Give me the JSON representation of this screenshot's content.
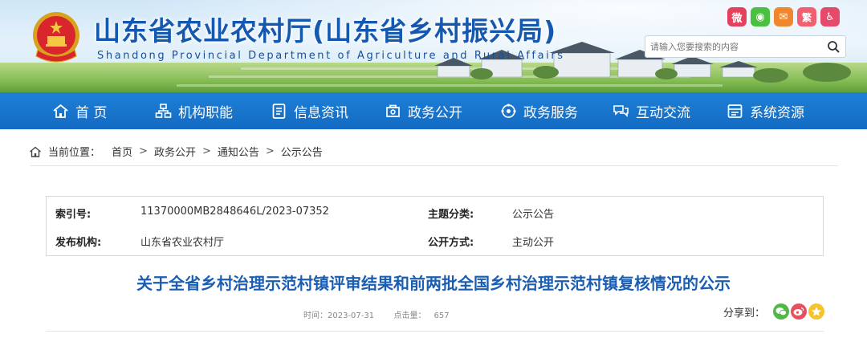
{
  "header": {
    "title": "山东省农业农村厅(山东省乡村振兴局)",
    "subtitle": "Shandong Provincial Department of Agriculture and Rural Affairs",
    "top_icons": [
      {
        "name": "weibo-icon",
        "glyph": "微"
      },
      {
        "name": "wechat-icon",
        "glyph": "◉"
      },
      {
        "name": "mail-icon",
        "glyph": "✉"
      },
      {
        "name": "traditional-chinese-icon",
        "glyph": "繁"
      },
      {
        "name": "accessibility-icon",
        "glyph": "♿"
      }
    ],
    "search": {
      "placeholder": "请输入您要搜索的内容"
    }
  },
  "nav": {
    "items": [
      {
        "label": "首 页",
        "icon": "home-icon"
      },
      {
        "label": "机构职能",
        "icon": "org-chart-icon"
      },
      {
        "label": "信息资讯",
        "icon": "document-icon"
      },
      {
        "label": "政务公开",
        "icon": "public-affairs-icon"
      },
      {
        "label": "政务服务",
        "icon": "service-icon"
      },
      {
        "label": "互动交流",
        "icon": "interaction-icon"
      },
      {
        "label": "系统资源",
        "icon": "resources-icon"
      }
    ]
  },
  "breadcrumb": {
    "prefix": "当前位置：",
    "items": [
      "首页",
      "政务公开",
      "通知公告",
      "公示公告"
    ],
    "separator": ">"
  },
  "meta": {
    "index_label": "索引号:",
    "index_value": "11370000MB2848646L/2023-07352",
    "category_label": "主题分类:",
    "category_value": "公示公告",
    "publisher_label": "发布机构:",
    "publisher_value": "山东省农业农村厅",
    "method_label": "公开方式:",
    "method_value": "主动公开"
  },
  "article": {
    "title": "关于全省乡村治理示范村镇评审结果和前两批全国乡村治理示范村镇复核情况的公示",
    "time_label": "时间：",
    "time_value": "2023-07-31",
    "hits_label": "点击量：",
    "hits_value": "657",
    "share_label": "分享到："
  },
  "colors": {
    "brand_blue": "#1558b0",
    "nav_blue": "#136bc3",
    "title_blue": "#1a5eb3"
  }
}
